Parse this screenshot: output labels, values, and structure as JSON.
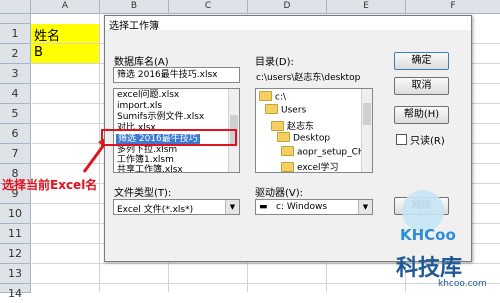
{
  "sheet": {
    "columns": [
      "A",
      "B",
      "C",
      "D",
      "E",
      "F"
    ],
    "rows": [
      "1",
      "2",
      "3",
      "4",
      "5",
      "6",
      "7",
      "8",
      "9",
      "10",
      "11",
      "12",
      "13",
      "14"
    ],
    "cells": {
      "a1": "姓名",
      "a2": "B"
    },
    "fill_color": "#ffff00"
  },
  "dialog": {
    "title": "选择工作簿",
    "library_label": "数据库名(A)",
    "library_value": "筛选 2016最牛技巧.xlsx",
    "file_list": [
      "excel问题.xlsx",
      "import.xls",
      "Sumifs示例文件.xlsx",
      "对比.xlsx",
      "筛选 2016最牛技巧",
      "多列下拉.xlsm",
      "工作簿1.xlsm",
      "共享工作簿.xlsx"
    ],
    "selected_index": 4,
    "directory_label": "目录(D):",
    "directory_value": "c:\\users\\赵志东\\desktop",
    "tree": [
      "c:\\",
      "Users",
      "赵志东",
      "Desktop",
      "aopr_setup_CH",
      "excel学习"
    ],
    "filetype_label": "文件类型(T):",
    "filetype_value": "Excel 文件(*.xls*)",
    "drive_label": "驱动器(V):",
    "drive_value": "c: Windows",
    "ok_label": "确定",
    "cancel_label": "取消",
    "help_label": "帮助(H)",
    "readonly_label": "只读(R)",
    "network_label": "网络"
  },
  "annotation": {
    "text": "选择当前Excel名",
    "color": "#e0141e"
  },
  "watermark": {
    "logo": "KHCoo",
    "name": "科技库",
    "url": "khcoo.com"
  }
}
